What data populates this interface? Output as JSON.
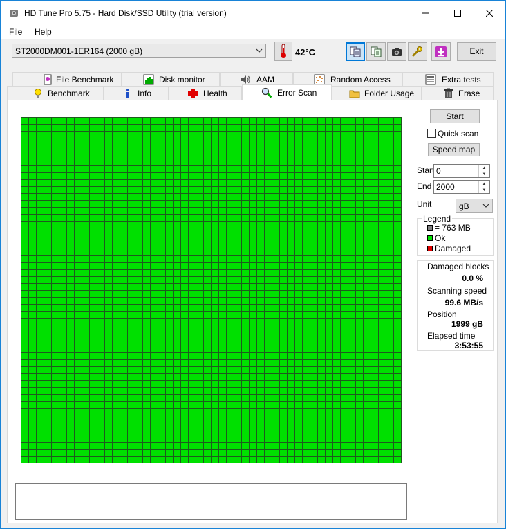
{
  "window": {
    "title": "HD Tune Pro 5.75 - Hard Disk/SSD Utility (trial version)"
  },
  "menu": {
    "file": "File",
    "help": "Help"
  },
  "toolbar": {
    "drive": "ST2000DM001-1ER164 (2000 gB)",
    "temperature": "42°C",
    "exit": "Exit"
  },
  "tabs": {
    "top": [
      "File Benchmark",
      "Disk monitor",
      "AAM",
      "Random Access",
      "Extra tests"
    ],
    "bottom": [
      "Benchmark",
      "Info",
      "Health",
      "Error Scan",
      "Folder Usage",
      "Erase"
    ],
    "selected": "Error Scan"
  },
  "scan_controls": {
    "start_button": "Start",
    "quick_scan": "Quick scan",
    "quick_scan_checked": false,
    "speed_map_button": "Speed map",
    "start_label": "Start",
    "start_value": "0",
    "end_label": "End",
    "end_value": "2000",
    "unit_label": "Unit",
    "unit_value": "gB"
  },
  "legend": {
    "title": "Legend",
    "block_size": "= 763 MB",
    "ok": "Ok",
    "damaged": "Damaged",
    "colors": {
      "block": "#808080",
      "ok": "#00e000",
      "damaged": "#e00000"
    }
  },
  "stats": {
    "damaged_blocks_label": "Damaged blocks",
    "damaged_blocks_value": "0.0 %",
    "scanning_speed_label": "Scanning speed",
    "scanning_speed_value": "99.6 MB/s",
    "position_label": "Position",
    "position_value": "1999 gB",
    "elapsed_label": "Elapsed time",
    "elapsed_value": "3:53:55"
  },
  "scan_map": {
    "status": "ok",
    "damaged_blocks": 0,
    "color": "#00e000"
  }
}
